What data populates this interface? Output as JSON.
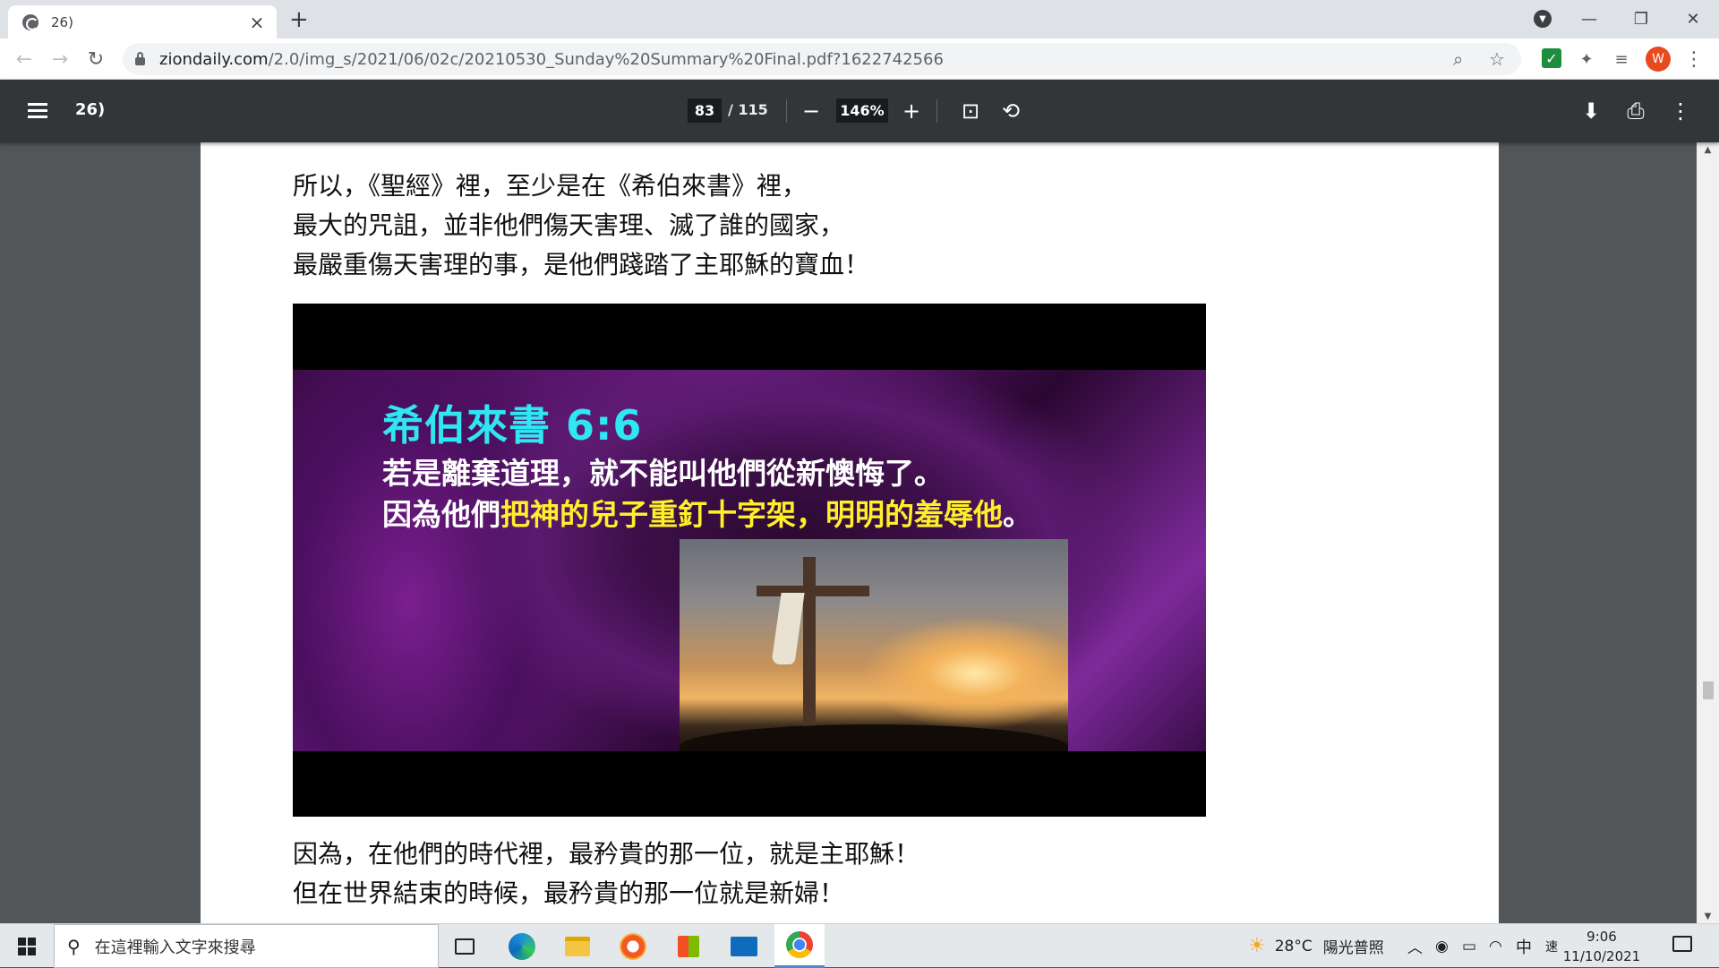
{
  "browser": {
    "tab_title": "26)",
    "tab_close": "×",
    "new_tab": "+",
    "url_host": "ziondaily.com",
    "url_rest": "/2.0/img_s/2021/06/02c/20210530_Sunday%20Summary%20Final.pdf?1622742566",
    "profile_initial": "W"
  },
  "pdf_toolbar": {
    "doc_title": "26)",
    "current_page": "83",
    "page_total": "/ 115",
    "zoom": "146%"
  },
  "page": {
    "paragraph_top": [
      "所以，《聖經》裡，至少是在《希伯來書》裡，",
      "最大的咒詛，並非他們傷天害理、滅了誰的國家，",
      "最嚴重傷天害理的事，是他們踐踏了主耶穌的寶血！"
    ],
    "paragraph_bottom": [
      "因為，在他們的時代裡，最矜貴的那一位，就是主耶穌！",
      "但在世界結束的時候，最矜貴的那一位就是新婦！"
    ],
    "slide": {
      "reference": "希伯來書 6:6",
      "line1": "若是離棄道理，就不能叫他們從新懊悔了。",
      "line2_prefix": "因為他們",
      "line2_highlight": "把神的兒子重釘十字架，明明的羞辱他",
      "line2_suffix": "。"
    }
  },
  "taskbar": {
    "search_placeholder": "在這裡輸入文字來搜尋",
    "weather_temp": "28°C",
    "weather_desc": "陽光普照",
    "ime_lang": "中",
    "ime_mode": "速",
    "time": "9:06",
    "date": "11/10/2021"
  },
  "colors": {
    "slide_reference": "#2fe6f2",
    "slide_highlight": "#ffef2b",
    "pdf_toolbar": "#323639",
    "viewer_background": "#525659"
  }
}
